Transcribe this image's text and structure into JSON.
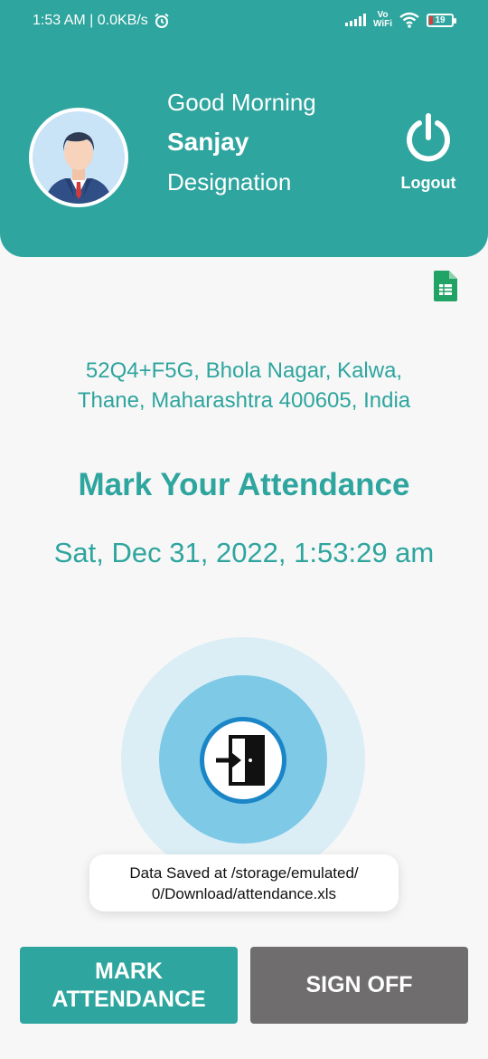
{
  "status_bar": {
    "time_info": "1:53 AM | 0.0KB/s",
    "alarm_icon": "alarm-clock-icon",
    "signal_icon": "signal-bars-icon",
    "vowifi_line1": "Vo",
    "vowifi_line2": "WiFi",
    "wifi_icon": "wifi-icon",
    "battery_level": "19"
  },
  "header": {
    "greeting": "Good Morning",
    "user_name": "Sanjay",
    "designation": "Designation",
    "logout_label": "Logout",
    "avatar_icon": "user-avatar-icon",
    "logout_icon": "power-icon",
    "accent_color": "#2ea59e"
  },
  "sheets_icon": "google-sheets-icon",
  "location": {
    "line1": "52Q4+F5G, Bhola Nagar, Kalwa,",
    "line2": "Thane, Maharashtra 400605, India"
  },
  "attendance": {
    "title": "Mark Your Attendance",
    "datetime": "Sat, Dec 31, 2022, 1:53:29 am",
    "door_icon": "door-enter-icon"
  },
  "toast": {
    "line1": "Data Saved at /storage/emulated/",
    "line2": "0/Download/attendance.xls"
  },
  "buttons": {
    "mark_line1": "MARK",
    "mark_line2": "ATTENDANCE",
    "sign_off": "SIGN OFF",
    "mark_color": "#2ea59e",
    "sign_off_color": "#6f6d6d"
  }
}
